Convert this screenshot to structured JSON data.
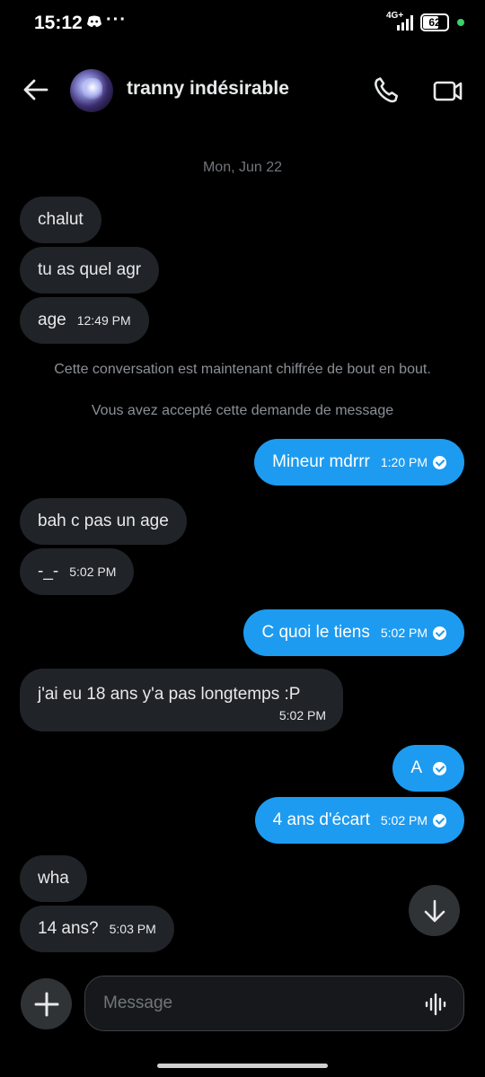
{
  "status_bar": {
    "time": "15:12",
    "more": "···",
    "network": "4G+",
    "battery": "62",
    "app_icon": "discord-icon"
  },
  "header": {
    "contact_name": "tranny indésirable",
    "back_icon": "arrow-left-icon",
    "call_icon": "phone-icon",
    "video_icon": "video-icon"
  },
  "conversation": {
    "date": "Mon, Jun 22",
    "system_notes": [
      "Cette conversation est maintenant chiffrée de bout en bout.",
      "Vous avez accepté cette demande de message"
    ],
    "messages": [
      {
        "dir": "in",
        "text": "chalut",
        "time": ""
      },
      {
        "dir": "in",
        "text": "tu as quel agr",
        "time": ""
      },
      {
        "dir": "in",
        "text": "age",
        "time": "12:49 PM"
      },
      {
        "dir": "out",
        "text": "Mineur mdrrr",
        "time": "1:20 PM"
      },
      {
        "dir": "in",
        "text": "bah c pas un age",
        "time": ""
      },
      {
        "dir": "in",
        "text": "-_-",
        "time": "5:02 PM"
      },
      {
        "dir": "out",
        "text": "C quoi le tiens",
        "time": "5:02 PM"
      },
      {
        "dir": "in",
        "text": "j'ai eu 18 ans y'a pas longtemps :P",
        "time": "5:02 PM"
      },
      {
        "dir": "out",
        "text": "A",
        "time": ""
      },
      {
        "dir": "out",
        "text": "4 ans d'écart",
        "time": "5:02 PM"
      },
      {
        "dir": "in",
        "text": "wha",
        "time": ""
      },
      {
        "dir": "in",
        "text": "14 ans?",
        "time": "5:03 PM"
      }
    ]
  },
  "composer": {
    "placeholder": "Message",
    "add_icon": "plus-icon",
    "voice_icon": "voice-wave-icon",
    "scroll_icon": "arrow-down-icon"
  },
  "colors": {
    "background": "#000000",
    "incoming_bubble": "#202327",
    "outgoing_bubble": "#1d9bf0",
    "muted_text": "#71767b"
  }
}
